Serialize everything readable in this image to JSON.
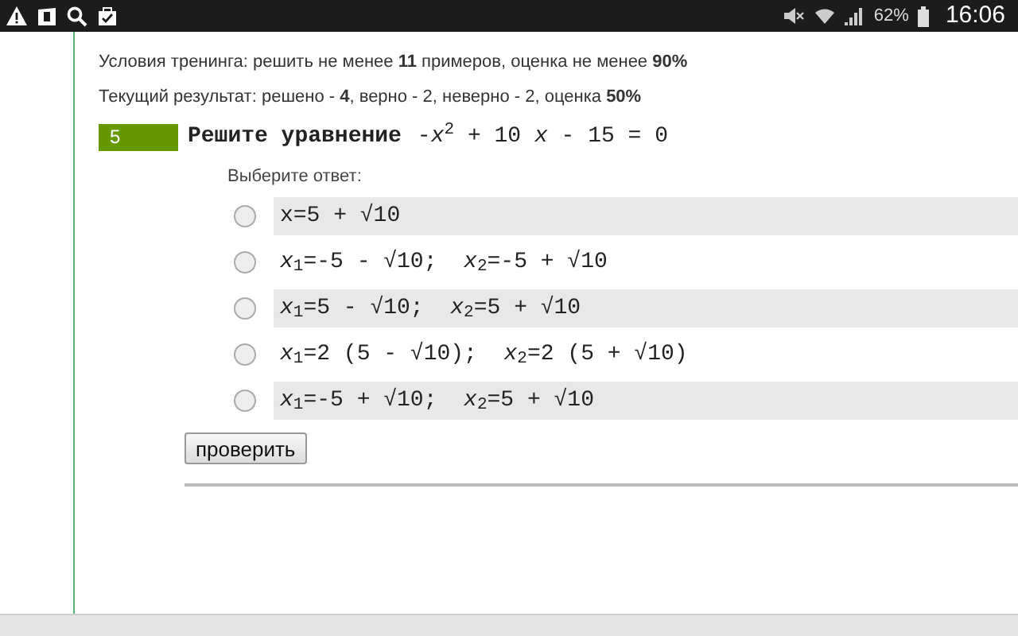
{
  "status_bar": {
    "battery": "62%",
    "time": "16:06"
  },
  "conditions": "Условия тренинга: решить не менее **11** примеров, оценка не менее **90%**",
  "result": "Текущий результат: решено - **4**, верно - 2, неверно - 2, оценка **50%**",
  "task": {
    "number": "5",
    "title": "Решите уравнение",
    "equation": "-*x*$^{2}$ + 10 *x* - 15 = 0"
  },
  "prompt": "Выберите ответ:",
  "options": [
    {
      "text": "x=5 + √10",
      "selected": false
    },
    {
      "text": "*x*$_{1}$=-5 - √10;  *x*$_{2}$=-5 + √10",
      "selected": false
    },
    {
      "text": "*x*$_{1}$=5 - √10;  *x*$_{2}$=5 + √10",
      "selected": false
    },
    {
      "text": "*x*$_{1}$=2 (5 - √10);  *x*$_{2}$=2 (5 + √10)",
      "selected": false
    },
    {
      "text": "*x*$_{1}$=-5 + √10;  *x*$_{2}$=5 + √10",
      "selected": false
    }
  ],
  "check_button": "проверить"
}
